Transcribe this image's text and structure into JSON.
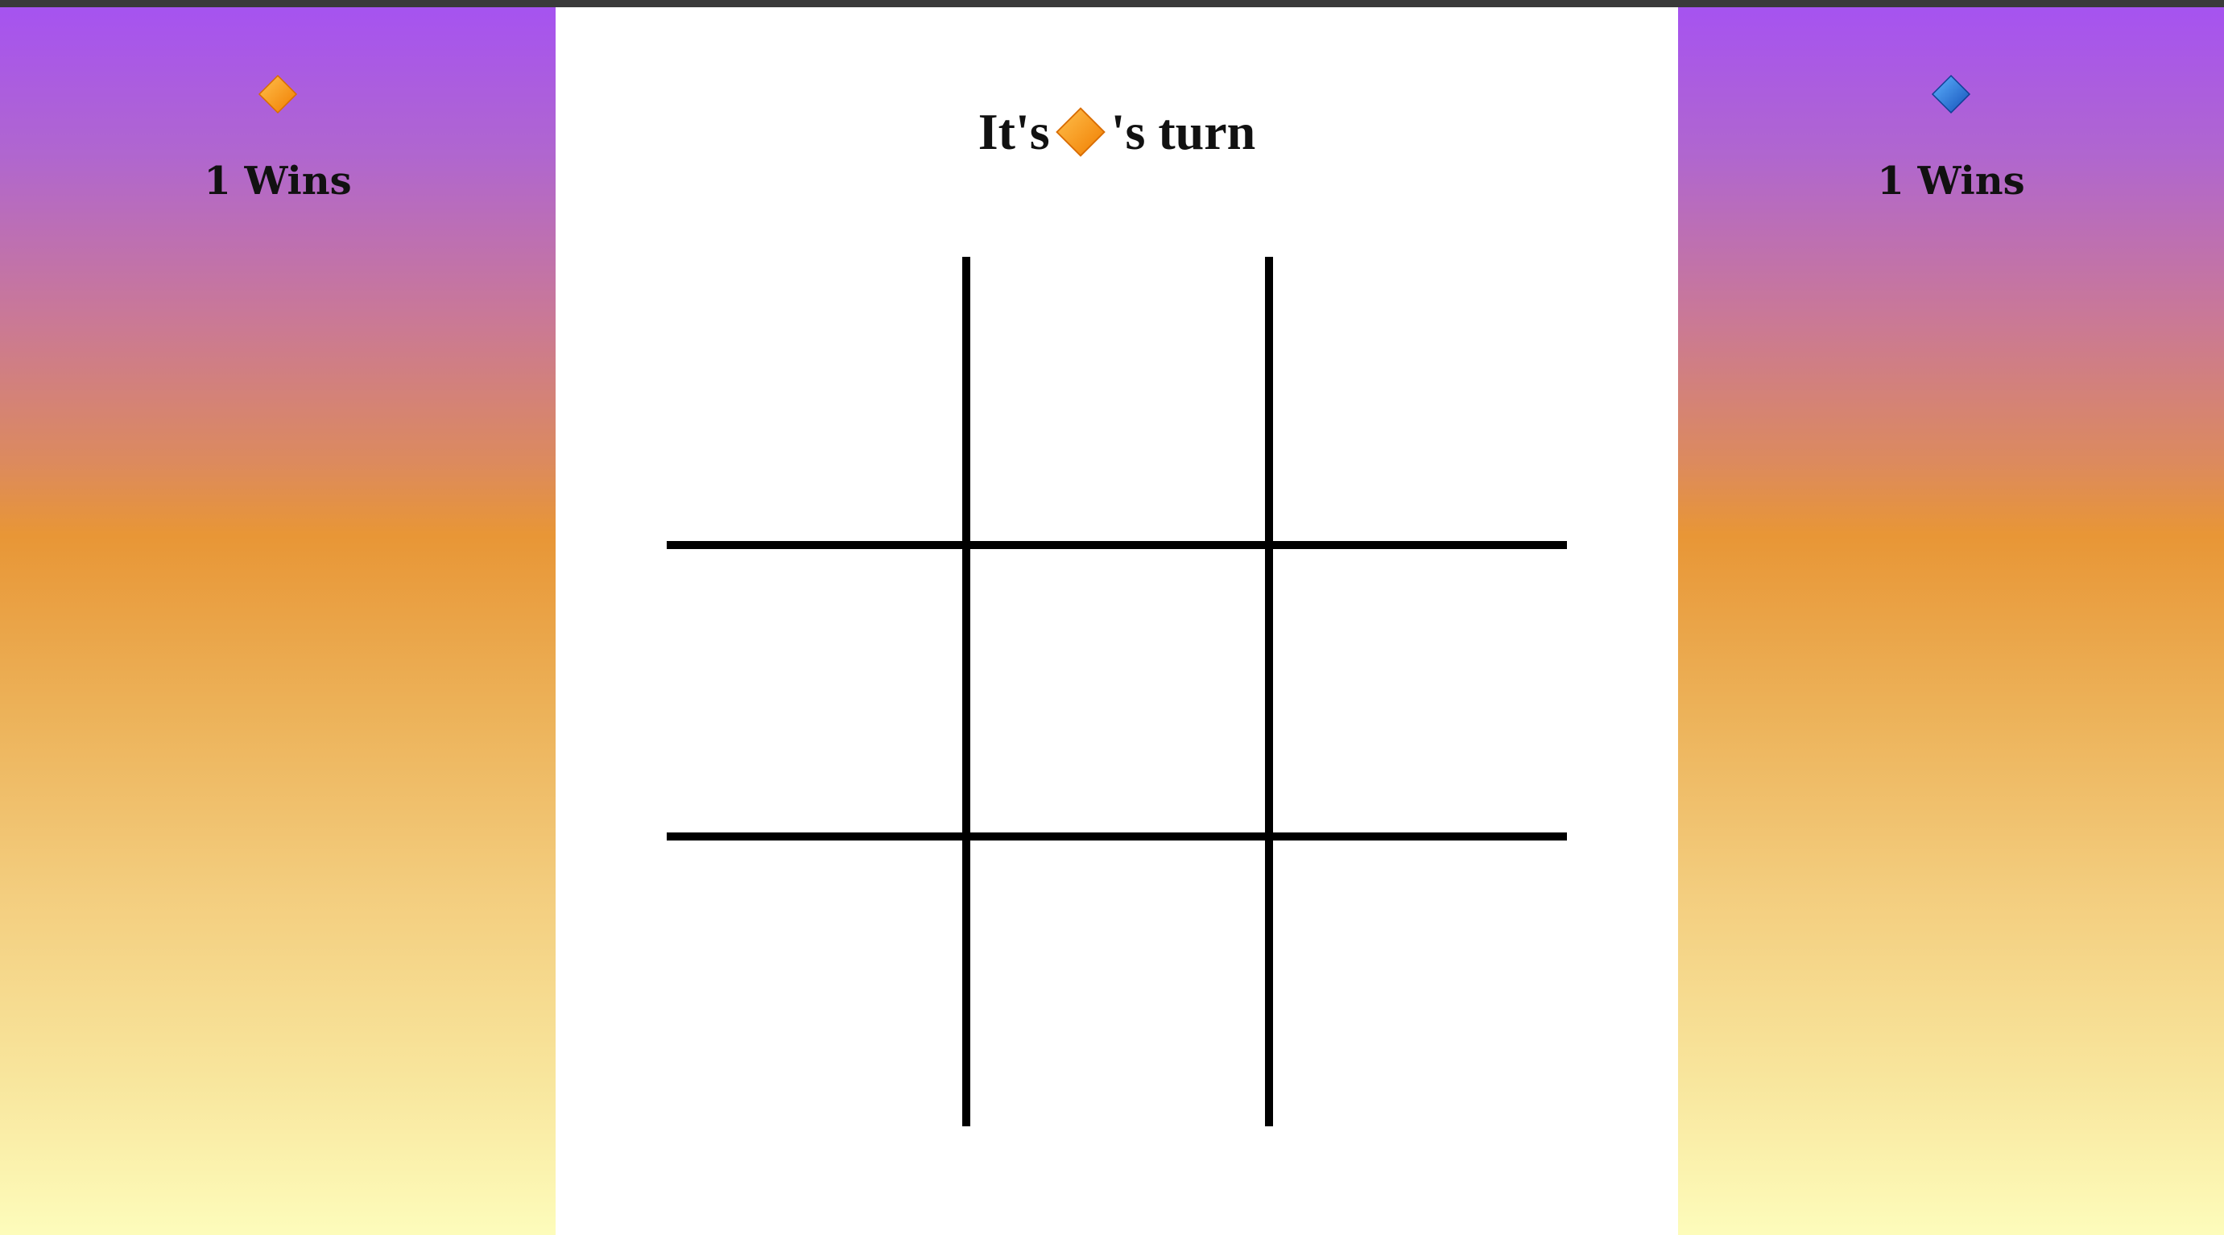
{
  "players": [
    {
      "id": "orange",
      "icon": "orange-diamond-icon",
      "color": "#ff9800",
      "wins_text": "1 Wins"
    },
    {
      "id": "blue",
      "icon": "blue-diamond-icon",
      "color": "#1e6fd9",
      "wins_text": "1 Wins"
    }
  ],
  "status": {
    "prefix": "It's",
    "current_player_icon": "orange-diamond-icon",
    "suffix": "'s turn"
  },
  "board": {
    "rows": 3,
    "cols": 3,
    "cells": [
      "",
      "",
      "",
      "",
      "",
      "",
      "",
      "",
      ""
    ]
  },
  "colors": {
    "gradient_top": "#a653f0",
    "gradient_mid": "#e89636",
    "gradient_bottom": "#fdfcbb",
    "grid_lines": "#000000"
  }
}
